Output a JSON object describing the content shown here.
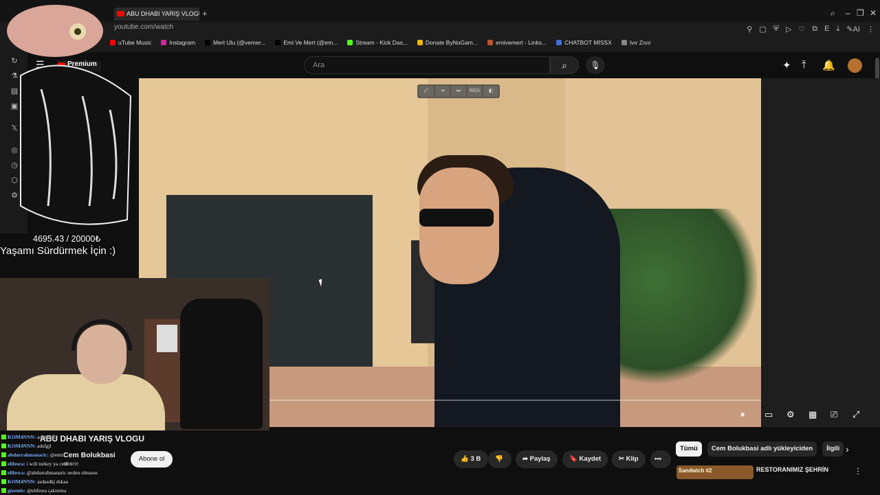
{
  "browser": {
    "tab_title": "ABU DHABI YARIŞ VLOGU",
    "new_tab": "+",
    "address": "youtube.com/watch",
    "window_controls": [
      "⌕",
      "–",
      "❐",
      "✕"
    ],
    "toolbar_icons": [
      "⚲",
      "▢",
      "⛨",
      "▷",
      "♡",
      "⧉",
      "E",
      "⤓",
      "✎AI",
      "⋮"
    ],
    "bookmarks": [
      {
        "label": "uTube Music",
        "color": "#ff0000"
      },
      {
        "label": "Instagram",
        "color": "#d6249f"
      },
      {
        "label": "Mert Ulu (@vemer...",
        "color": "#000000"
      },
      {
        "label": "Emi Ve Mert (@em...",
        "color": "#000000"
      },
      {
        "label": "Stream - Kick Das...",
        "color": "#53fc18"
      },
      {
        "label": "Donate ByNoGam...",
        "color": "#f5b400"
      },
      {
        "label": "emivemert - Links...",
        "color": "#c0502a"
      },
      {
        "label": "CHATBOT MİSSX",
        "color": "#3b6fd6"
      },
      {
        "label": "Ivır Zıvır",
        "color": "#888888"
      }
    ]
  },
  "sidebar_icons": [
    "↻",
    "⚗",
    "▤",
    "▣",
    "𝕏",
    "◎",
    "◷",
    "⬡",
    "⚙"
  ],
  "youtube": {
    "logo": "Premium",
    "hamburger": "☰",
    "search_placeholder": "Ara",
    "search_icon": "⌕",
    "mic_icon": "🎙",
    "header_icons": [
      "✦",
      "⤒",
      "🔔"
    ]
  },
  "video": {
    "tools": [
      "⤢",
      "⇥",
      "⏭",
      "RGX",
      "◧"
    ],
    "controls": [
      "⏸",
      "▭",
      "⚙",
      "▦",
      "⎚",
      "⤢"
    ]
  },
  "overlay": {
    "donation": "4695.43 / 20000₺",
    "line": "Yaşamı Sürdürmek İçin :)"
  },
  "meta": {
    "title": "ABU DHABI YARIŞ VLOGU",
    "channel": "Cem Bolukbasi",
    "subscribers": "abone",
    "subscribe": "Abone ol",
    "likes": "3 B",
    "share": "Paylaş",
    "save": "Kaydet",
    "clip": "Klip",
    "more": "•••"
  },
  "chips": [
    "Tümü",
    "Cem Bolukbasi adlı yükleyiciden",
    "İlgili"
  ],
  "recommendation": {
    "thumb_text": "Sandwich #2",
    "title": "RESTORANIMIZ ŞEHRİN"
  },
  "chat": [
    {
      "user": "KOM4NNN:",
      "msg": "adsklfkfl"
    },
    {
      "user": "KOM4NNN:",
      "msg": "adsfgjl"
    },
    {
      "user": "abdurrahmanaric:",
      "msg": "@emi..."
    },
    {
      "user": "elifesra:",
      "msg": "i will turkey ya cesh o"
    },
    {
      "user": "elifesra:",
      "msg": "@abdurrahmanaric neden olmasın"
    },
    {
      "user": "KOM4NNN:",
      "msg": "asdasdkj dskaa"
    },
    {
      "user": "gizemls:",
      "msg": "@elifesra çaktırma"
    }
  ]
}
